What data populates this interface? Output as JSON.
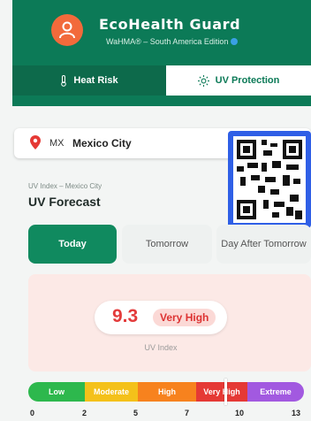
{
  "header": {
    "app_name": "EcoHealth Guard",
    "tagline": "WaHMA® – South America Edition",
    "tabs": [
      {
        "label": "Heat Risk",
        "icon": "thermometer-icon",
        "active": false
      },
      {
        "label": "UV Protection",
        "icon": "sun-icon",
        "active": true
      }
    ]
  },
  "location": {
    "country_code": "MX",
    "city": "Mexico City",
    "icon": "location-pin-icon"
  },
  "forecast": {
    "subtitle": "UV Index – Mexico City",
    "title": "UV Forecast",
    "days": [
      "Today",
      "Tomorrow",
      "Day After Tomorrow"
    ],
    "selected_day": "Today"
  },
  "uv": {
    "value": "9.3",
    "level": "Very High",
    "label": "UV Index"
  },
  "scale": {
    "segments": [
      {
        "label": "Low",
        "color": "#2db84d"
      },
      {
        "label": "Moderate",
        "color": "#f4c11a"
      },
      {
        "label": "High",
        "color": "#f7821e"
      },
      {
        "label": "Very High",
        "color": "#e53935"
      },
      {
        "label": "Extreme",
        "color": "#a259e0"
      }
    ],
    "ticks": [
      "0",
      "2",
      "5",
      "7",
      "10",
      "13"
    ],
    "marker_value": 9.3
  },
  "colors": {
    "brand_green": "#0c7a57",
    "accent_red": "#e33b3b"
  }
}
